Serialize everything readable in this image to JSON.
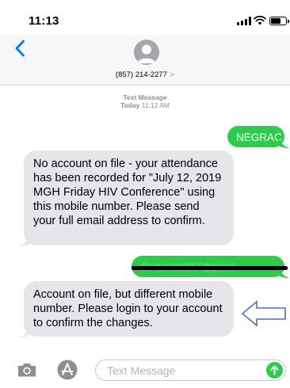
{
  "status_bar": {
    "time": "11:13",
    "icons": [
      "signal-icon",
      "wifi-icon",
      "battery-icon"
    ]
  },
  "header": {
    "back_icon": "chevron-left-icon",
    "contact": "(857) 214-2277",
    "contact_chevron": ">"
  },
  "thread": {
    "label": "Text Message",
    "day": "Today",
    "time": "11:12 AM"
  },
  "messages": [
    {
      "direction": "outgoing",
      "text": "NEGRAC"
    },
    {
      "direction": "incoming",
      "text": "No account on file - your attendance has been recorded for \"July 12, 2019 MGH Friday HIV Conference\" using this mobile number. Please send your full email address to confirm."
    },
    {
      "direction": "outgoing",
      "text": "Emilycaldell17@gmail",
      "redacted": true
    },
    {
      "direction": "incoming",
      "text": "Account on file, but different mobile number. Please login to your account to confirm the changes."
    }
  ],
  "input_bar": {
    "placeholder": "Text Message",
    "icons": [
      "camera-icon",
      "app-store-icon",
      "send-arrow-icon"
    ]
  },
  "colors": {
    "outgoing_bubble": "#2ecc4b",
    "incoming_bubble": "#e5e5ea",
    "ios_blue": "#007aff",
    "annotation_arrow": "#4a72b8"
  }
}
